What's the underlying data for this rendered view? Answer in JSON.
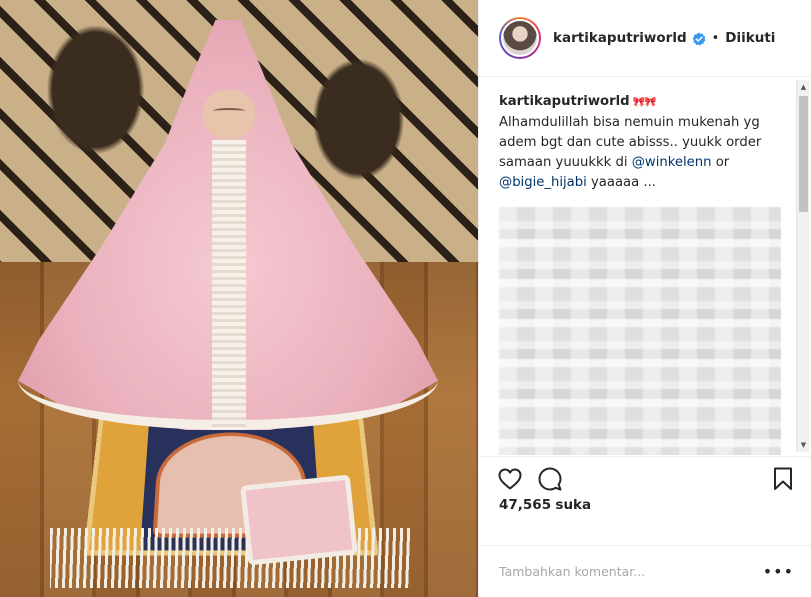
{
  "header": {
    "username": "kartikaputriworld",
    "separator": "•",
    "follow_status": "Diikuti"
  },
  "caption": {
    "username": "kartikaputriworld",
    "emoji": "🎀🎀",
    "text_1": "Alhamdulillah bisa nemuin mukenah yg adem bgt dan cute abisss.. yuukk order samaan yuuukkk di",
    "mention_1": "@winkelenn",
    "text_2": "or",
    "mention_2": "@bigie_hijabi",
    "text_3": "yaaaaa ..."
  },
  "actions": {
    "like_icon": "heart-icon",
    "comment_icon": "comment-icon",
    "save_icon": "bookmark-icon"
  },
  "likes": {
    "count": "47,565",
    "label": "suka"
  },
  "comment_box": {
    "placeholder": "Tambahkan komentar...",
    "more_label": "•••"
  },
  "colors": {
    "accent_link": "#003569",
    "verified": "#3897f0",
    "text": "#262626"
  }
}
